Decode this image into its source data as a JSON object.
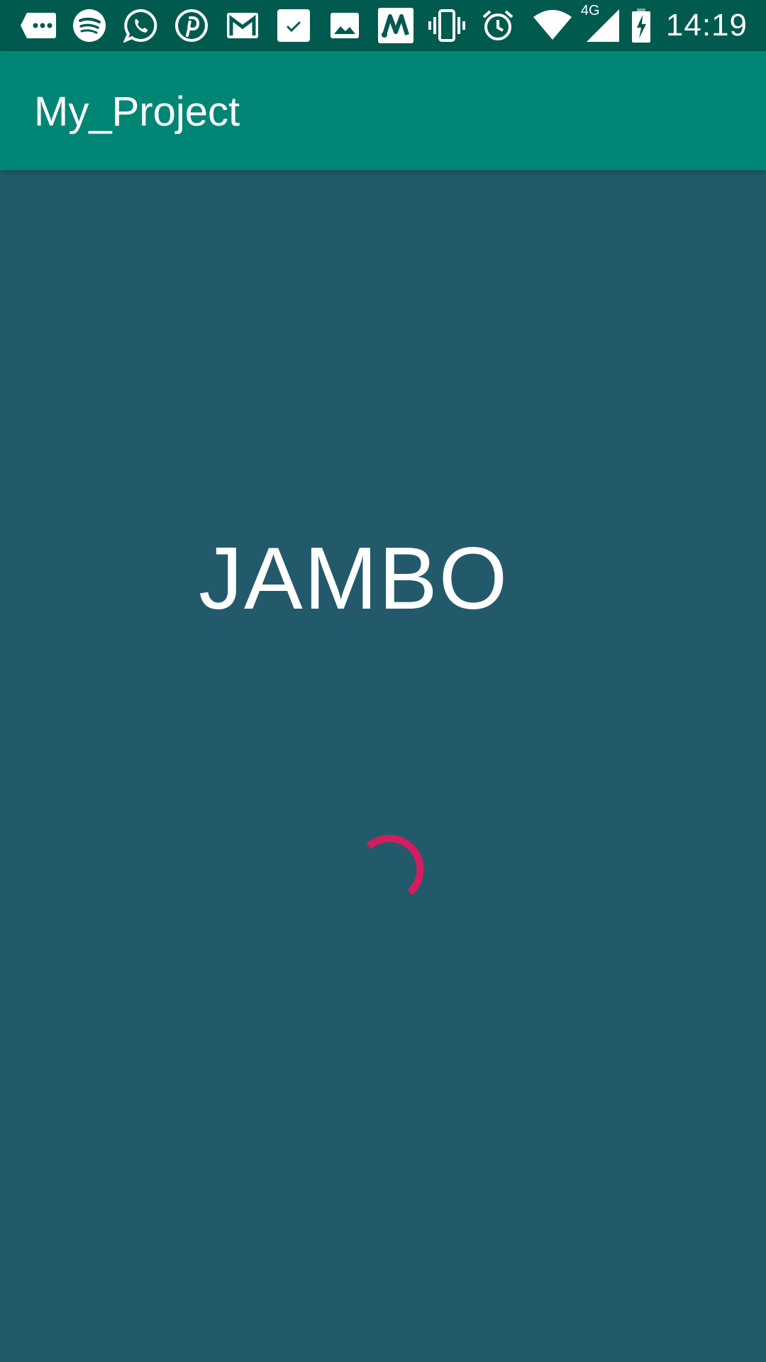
{
  "status_bar": {
    "time": "14:19",
    "network_label": "4G",
    "icons": [
      "messages-icon",
      "spotify-icon",
      "whatsapp-icon",
      "pinterest-icon",
      "gmail-icon",
      "tasks-icon",
      "gallery-icon",
      "app-m-icon",
      "vibrate-icon",
      "alarm-icon",
      "wifi-icon",
      "cell-signal-icon",
      "battery-charging-icon"
    ]
  },
  "app_bar": {
    "title": "My_Project"
  },
  "main": {
    "greeting": "JAMBO"
  },
  "colors": {
    "status_bar_bg": "#005a4e",
    "app_bar_bg": "#018675",
    "content_bg": "#235a6b",
    "spinner": "#d81b60"
  }
}
